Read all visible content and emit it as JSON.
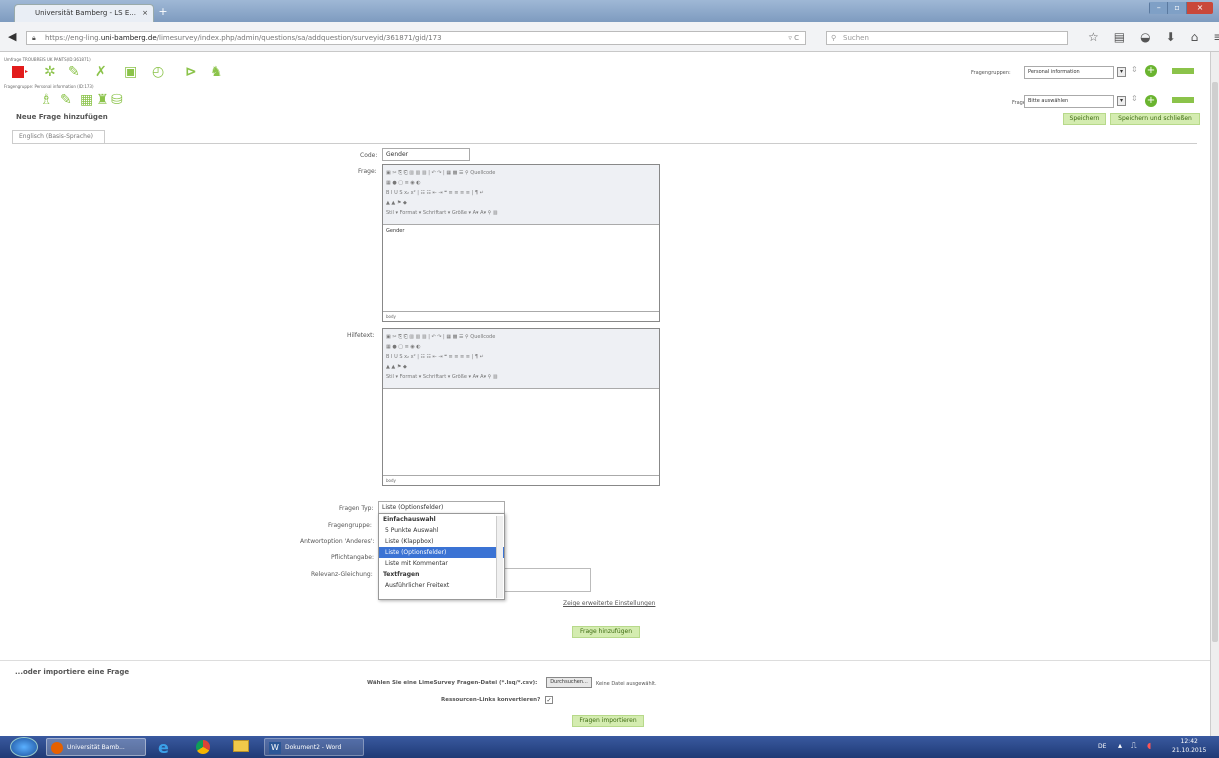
{
  "browser": {
    "tab_title": "Universität Bamberg - LS E...",
    "tab_close": "×",
    "new_tab": "+",
    "url_prefix": "https://eng-ling.",
    "url_domain": "uni-bamberg.de",
    "url_path": "/limesurvey/index.php/admin/questions/sa/addquestion/surveyid/361871/gid/173",
    "search_placeholder": "Suchen",
    "reload": "▿ C"
  },
  "survey_info": "Umfrage TROUBREIS UK PANTS(ID:361871)",
  "group_info": "Fragengruppe: Personal information (ID:173)",
  "top_right": {
    "group_label": "Fragengruppen:",
    "group_value": "Personal information",
    "question_label": "Fragen:",
    "question_value": "Bitte auswählen"
  },
  "page": {
    "heading": "Neue Frage hinzufügen",
    "save": "Speichern",
    "save_close": "Speichern und schließen",
    "lang_tab": "Englisch (Basis-Sprache)"
  },
  "form": {
    "code_label": "Code:",
    "code_value": "Gender",
    "question_label": "Frage:",
    "question_text": "Gender",
    "help_label": "Hilfetext:",
    "editor_footer": "body",
    "type_label": "Fragen Typ:",
    "type_value": "Liste (Optionsfelder)",
    "group_label": "Fragengruppe:",
    "other_label": "Antwortoption 'Anderes':",
    "mandatory_label": "Pflichtangabe:",
    "relevance_label": "Relevanz-Gleichung:",
    "advanced_link": "Zeige erweiterte Einstellungen",
    "add_button": "Frage hinzufügen"
  },
  "dropdown": {
    "group1": "Einfachauswahl",
    "items": [
      "5 Punkte Auswahl",
      "Liste (Klappbox)",
      "Liste (Optionsfelder)",
      "Liste mit Kommentar"
    ],
    "group2": "Textfragen",
    "item_last": "Ausführlicher Freitext"
  },
  "import": {
    "heading": "...oder importiere eine Frage",
    "file_label": "Wählen Sie eine LimeSurvey Fragen-Datei (*.lsq/*.csv):",
    "browse": "Durchsuchen...",
    "no_file": "Keine Datei ausgewählt.",
    "convert_label": "Ressourcen-Links konvertieren?",
    "import_button": "Fragen importieren"
  },
  "taskbar": {
    "firefox": "Universität Bamb...",
    "word": "Dokument2 - Word",
    "lang": "DE",
    "time": "12:42",
    "date": "21.10.2015"
  },
  "colors": {
    "accent": "#8bc34a",
    "selected": "#3b73d4"
  }
}
